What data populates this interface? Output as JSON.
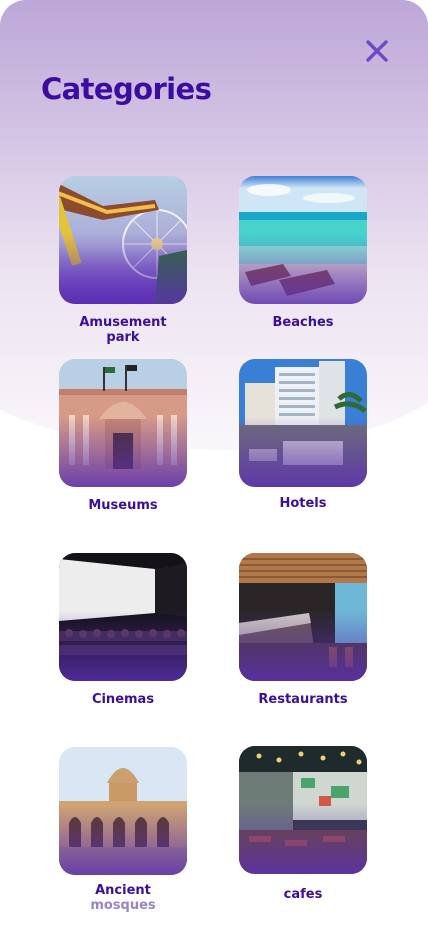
{
  "header": {
    "title": "Categories",
    "close_icon": "close-icon"
  },
  "colors": {
    "title": "#3a0ca0",
    "label": "#3b0f9b",
    "close": "#6c49c9",
    "tile_overlay": "#5a2fb0"
  },
  "categories": [
    {
      "label_line1": "Amusement",
      "label_line2": "park"
    },
    {
      "label_line1": "Beaches",
      "label_line2": ""
    },
    {
      "label_line1": "Museums",
      "label_line2": ""
    },
    {
      "label_line1": "Hotels",
      "label_line2": ""
    },
    {
      "label_line1": "Cinemas",
      "label_line2": ""
    },
    {
      "label_line1": "Restaurants",
      "label_line2": ""
    },
    {
      "label_line1": "Ancient",
      "label_line2": "mosques"
    },
    {
      "label_line1": "cafes",
      "label_line2": ""
    }
  ]
}
